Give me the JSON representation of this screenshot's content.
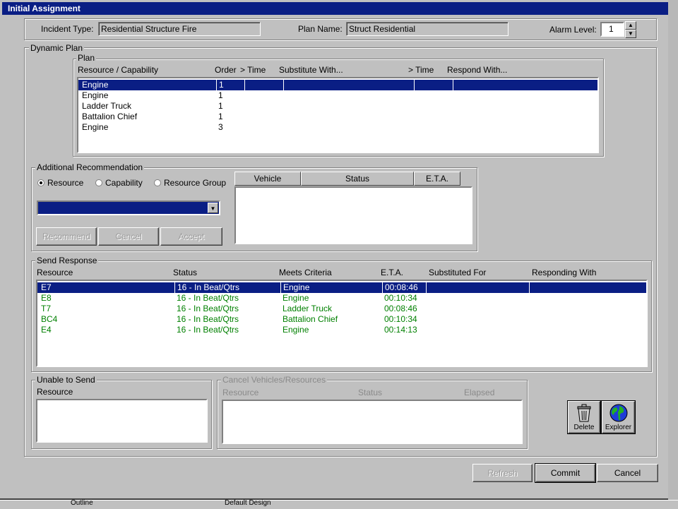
{
  "window": {
    "title": "Initial Assignment"
  },
  "header": {
    "incident_type_label": "Incident Type:",
    "incident_type_value": "Residential Structure Fire",
    "plan_name_label": "Plan Name:",
    "plan_name_value": "Struct Residential",
    "alarm_level_label": "Alarm Level:",
    "alarm_level_value": "1"
  },
  "dynamic_plan": {
    "legend": "Dynamic Plan",
    "plan": {
      "legend": "Plan",
      "columns": [
        "Resource / Capability",
        "Order",
        "> Time",
        "Substitute With...",
        "> Time",
        "Respond With..."
      ],
      "rows": [
        {
          "resource": "Engine",
          "order": "1"
        },
        {
          "resource": "Engine",
          "order": "1"
        },
        {
          "resource": "Ladder Truck",
          "order": "1"
        },
        {
          "resource": "Battalion Chief",
          "order": "1"
        },
        {
          "resource": "Engine",
          "order": "3"
        }
      ]
    },
    "additional": {
      "legend": "Additional Recommendation",
      "radio_resource": "Resource",
      "radio_capability": "Capability",
      "radio_group": "Resource Group",
      "vehicle_col": "Vehicle",
      "status_col": "Status",
      "eta_col": "E.T.A.",
      "recommend_btn": "Recommend",
      "cancel_btn": "Cancel",
      "accept_btn": "Accept"
    },
    "send": {
      "legend": "Send Response",
      "columns": [
        "Resource",
        "Status",
        "Meets Criteria",
        "E.T.A.",
        "Substituted For",
        "Responding With"
      ],
      "rows": [
        {
          "resource": "E7",
          "status": "16 - In Beat/Qtrs",
          "criteria": "Engine",
          "eta": "00:08:46"
        },
        {
          "resource": "E8",
          "status": "16 - In Beat/Qtrs",
          "criteria": "Engine",
          "eta": "00:10:34"
        },
        {
          "resource": "T7",
          "status": "16 - In Beat/Qtrs",
          "criteria": "Ladder Truck",
          "eta": "00:08:46"
        },
        {
          "resource": "BC4",
          "status": "16 - In Beat/Qtrs",
          "criteria": "Battalion Chief",
          "eta": "00:10:34"
        },
        {
          "resource": "E4",
          "status": "16 - In Beat/Qtrs",
          "criteria": "Engine",
          "eta": "00:14:13"
        }
      ]
    },
    "unable": {
      "legend": "Unable to Send",
      "resource_col": "Resource"
    },
    "cancel_vehicles": {
      "legend": "Cancel Vehicles/Resources",
      "resource_col": "Resource",
      "status_col": "Status",
      "elapsed_col": "Elapsed"
    },
    "delete_label": "Delete",
    "explorer_label": "Explorer"
  },
  "footer": {
    "refresh": "Refresh",
    "commit": "Commit",
    "cancel": "Cancel"
  },
  "taskbar": {
    "left_text": "Outline",
    "mid_text": "Default Design"
  },
  "colors": {
    "selection": "#0a1e84",
    "green_text": "#008000",
    "face": "#c0c0c0"
  }
}
